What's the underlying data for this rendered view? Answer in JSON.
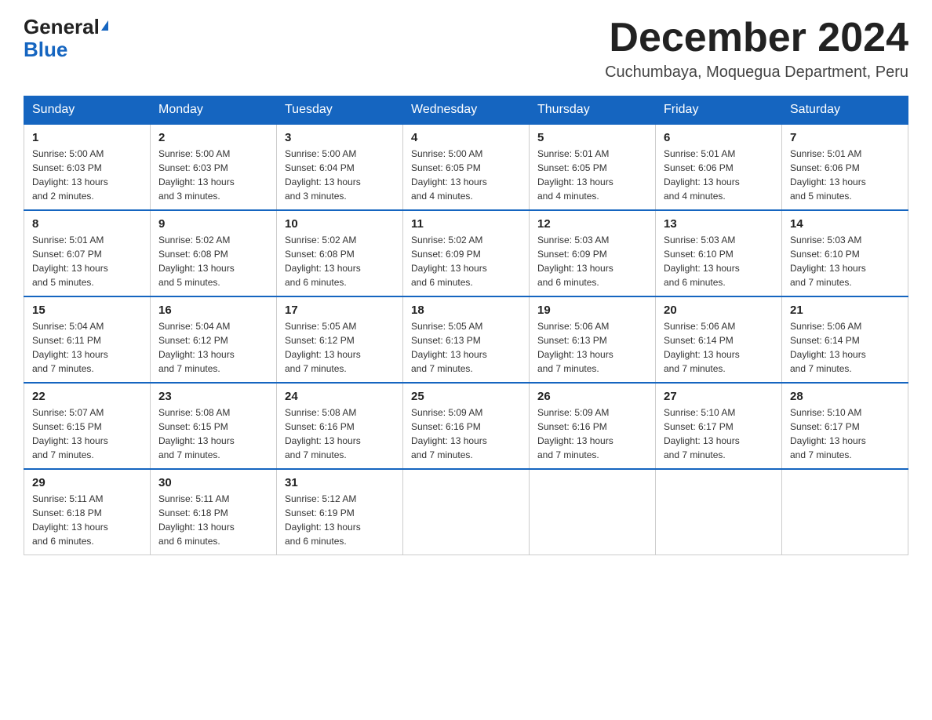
{
  "logo": {
    "general": "General",
    "blue": "Blue"
  },
  "title": "December 2024",
  "subtitle": "Cuchumbaya, Moquegua Department, Peru",
  "days_of_week": [
    "Sunday",
    "Monday",
    "Tuesday",
    "Wednesday",
    "Thursday",
    "Friday",
    "Saturday"
  ],
  "weeks": [
    [
      {
        "day": "1",
        "sunrise": "Sunrise: 5:00 AM",
        "sunset": "Sunset: 6:03 PM",
        "daylight": "Daylight: 13 hours and 2 minutes."
      },
      {
        "day": "2",
        "sunrise": "Sunrise: 5:00 AM",
        "sunset": "Sunset: 6:03 PM",
        "daylight": "Daylight: 13 hours and 3 minutes."
      },
      {
        "day": "3",
        "sunrise": "Sunrise: 5:00 AM",
        "sunset": "Sunset: 6:04 PM",
        "daylight": "Daylight: 13 hours and 3 minutes."
      },
      {
        "day": "4",
        "sunrise": "Sunrise: 5:00 AM",
        "sunset": "Sunset: 6:05 PM",
        "daylight": "Daylight: 13 hours and 4 minutes."
      },
      {
        "day": "5",
        "sunrise": "Sunrise: 5:01 AM",
        "sunset": "Sunset: 6:05 PM",
        "daylight": "Daylight: 13 hours and 4 minutes."
      },
      {
        "day": "6",
        "sunrise": "Sunrise: 5:01 AM",
        "sunset": "Sunset: 6:06 PM",
        "daylight": "Daylight: 13 hours and 4 minutes."
      },
      {
        "day": "7",
        "sunrise": "Sunrise: 5:01 AM",
        "sunset": "Sunset: 6:06 PM",
        "daylight": "Daylight: 13 hours and 5 minutes."
      }
    ],
    [
      {
        "day": "8",
        "sunrise": "Sunrise: 5:01 AM",
        "sunset": "Sunset: 6:07 PM",
        "daylight": "Daylight: 13 hours and 5 minutes."
      },
      {
        "day": "9",
        "sunrise": "Sunrise: 5:02 AM",
        "sunset": "Sunset: 6:08 PM",
        "daylight": "Daylight: 13 hours and 5 minutes."
      },
      {
        "day": "10",
        "sunrise": "Sunrise: 5:02 AM",
        "sunset": "Sunset: 6:08 PM",
        "daylight": "Daylight: 13 hours and 6 minutes."
      },
      {
        "day": "11",
        "sunrise": "Sunrise: 5:02 AM",
        "sunset": "Sunset: 6:09 PM",
        "daylight": "Daylight: 13 hours and 6 minutes."
      },
      {
        "day": "12",
        "sunrise": "Sunrise: 5:03 AM",
        "sunset": "Sunset: 6:09 PM",
        "daylight": "Daylight: 13 hours and 6 minutes."
      },
      {
        "day": "13",
        "sunrise": "Sunrise: 5:03 AM",
        "sunset": "Sunset: 6:10 PM",
        "daylight": "Daylight: 13 hours and 6 minutes."
      },
      {
        "day": "14",
        "sunrise": "Sunrise: 5:03 AM",
        "sunset": "Sunset: 6:10 PM",
        "daylight": "Daylight: 13 hours and 7 minutes."
      }
    ],
    [
      {
        "day": "15",
        "sunrise": "Sunrise: 5:04 AM",
        "sunset": "Sunset: 6:11 PM",
        "daylight": "Daylight: 13 hours and 7 minutes."
      },
      {
        "day": "16",
        "sunrise": "Sunrise: 5:04 AM",
        "sunset": "Sunset: 6:12 PM",
        "daylight": "Daylight: 13 hours and 7 minutes."
      },
      {
        "day": "17",
        "sunrise": "Sunrise: 5:05 AM",
        "sunset": "Sunset: 6:12 PM",
        "daylight": "Daylight: 13 hours and 7 minutes."
      },
      {
        "day": "18",
        "sunrise": "Sunrise: 5:05 AM",
        "sunset": "Sunset: 6:13 PM",
        "daylight": "Daylight: 13 hours and 7 minutes."
      },
      {
        "day": "19",
        "sunrise": "Sunrise: 5:06 AM",
        "sunset": "Sunset: 6:13 PM",
        "daylight": "Daylight: 13 hours and 7 minutes."
      },
      {
        "day": "20",
        "sunrise": "Sunrise: 5:06 AM",
        "sunset": "Sunset: 6:14 PM",
        "daylight": "Daylight: 13 hours and 7 minutes."
      },
      {
        "day": "21",
        "sunrise": "Sunrise: 5:06 AM",
        "sunset": "Sunset: 6:14 PM",
        "daylight": "Daylight: 13 hours and 7 minutes."
      }
    ],
    [
      {
        "day": "22",
        "sunrise": "Sunrise: 5:07 AM",
        "sunset": "Sunset: 6:15 PM",
        "daylight": "Daylight: 13 hours and 7 minutes."
      },
      {
        "day": "23",
        "sunrise": "Sunrise: 5:08 AM",
        "sunset": "Sunset: 6:15 PM",
        "daylight": "Daylight: 13 hours and 7 minutes."
      },
      {
        "day": "24",
        "sunrise": "Sunrise: 5:08 AM",
        "sunset": "Sunset: 6:16 PM",
        "daylight": "Daylight: 13 hours and 7 minutes."
      },
      {
        "day": "25",
        "sunrise": "Sunrise: 5:09 AM",
        "sunset": "Sunset: 6:16 PM",
        "daylight": "Daylight: 13 hours and 7 minutes."
      },
      {
        "day": "26",
        "sunrise": "Sunrise: 5:09 AM",
        "sunset": "Sunset: 6:16 PM",
        "daylight": "Daylight: 13 hours and 7 minutes."
      },
      {
        "day": "27",
        "sunrise": "Sunrise: 5:10 AM",
        "sunset": "Sunset: 6:17 PM",
        "daylight": "Daylight: 13 hours and 7 minutes."
      },
      {
        "day": "28",
        "sunrise": "Sunrise: 5:10 AM",
        "sunset": "Sunset: 6:17 PM",
        "daylight": "Daylight: 13 hours and 7 minutes."
      }
    ],
    [
      {
        "day": "29",
        "sunrise": "Sunrise: 5:11 AM",
        "sunset": "Sunset: 6:18 PM",
        "daylight": "Daylight: 13 hours and 6 minutes."
      },
      {
        "day": "30",
        "sunrise": "Sunrise: 5:11 AM",
        "sunset": "Sunset: 6:18 PM",
        "daylight": "Daylight: 13 hours and 6 minutes."
      },
      {
        "day": "31",
        "sunrise": "Sunrise: 5:12 AM",
        "sunset": "Sunset: 6:19 PM",
        "daylight": "Daylight: 13 hours and 6 minutes."
      },
      null,
      null,
      null,
      null
    ]
  ]
}
